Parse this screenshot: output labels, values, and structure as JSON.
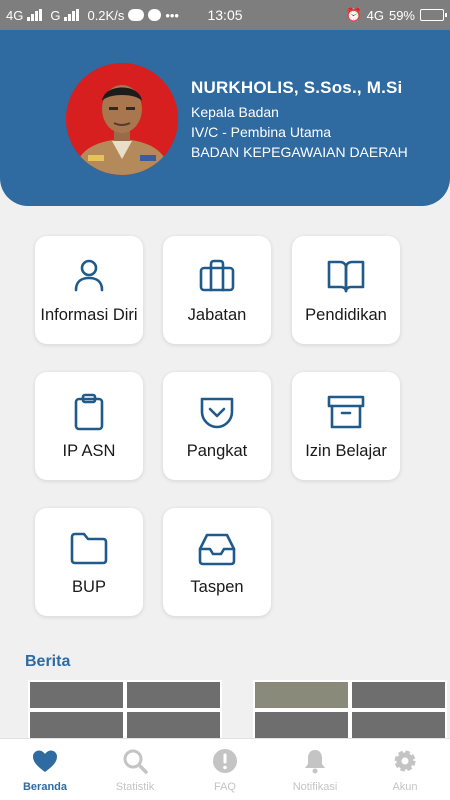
{
  "status_bar": {
    "network1": "4G",
    "network2": "G",
    "speed": "0.2K/s",
    "time": "13:05",
    "network3": "4G",
    "battery": "59%"
  },
  "profile": {
    "name": "NURKHOLIS, S.Sos., M.Si",
    "position": "Kepala Badan",
    "rank": "IV/C - Pembina Utama",
    "agency": "BADAN KEPEGAWAIAN DAERAH"
  },
  "menu": [
    {
      "label": "Informasi Diri",
      "icon": "person-icon"
    },
    {
      "label": "Jabatan",
      "icon": "briefcase-icon"
    },
    {
      "label": "Pendidikan",
      "icon": "book-icon"
    },
    {
      "label": "IP ASN",
      "icon": "clipboard-icon"
    },
    {
      "label": "Pangkat",
      "icon": "chevron-badge-icon"
    },
    {
      "label": "Izin Belajar",
      "icon": "archive-icon"
    },
    {
      "label": "BUP",
      "icon": "folder-icon"
    },
    {
      "label": "Taspen",
      "icon": "inbox-icon"
    }
  ],
  "news": {
    "title": "Berita"
  },
  "bottom_nav": [
    {
      "label": "Beranda",
      "icon": "heart-icon",
      "active": true
    },
    {
      "label": "Statistik",
      "icon": "search-icon"
    },
    {
      "label": "FAQ",
      "icon": "info-icon"
    },
    {
      "label": "Notifikasi",
      "icon": "bell-icon"
    },
    {
      "label": "Akun",
      "icon": "gear-icon"
    }
  ],
  "colors": {
    "primary": "#2f6aa0",
    "icon": "#1f5a8a",
    "avatar_bg": "#d81f1f",
    "inactive": "#c4c4c4"
  }
}
